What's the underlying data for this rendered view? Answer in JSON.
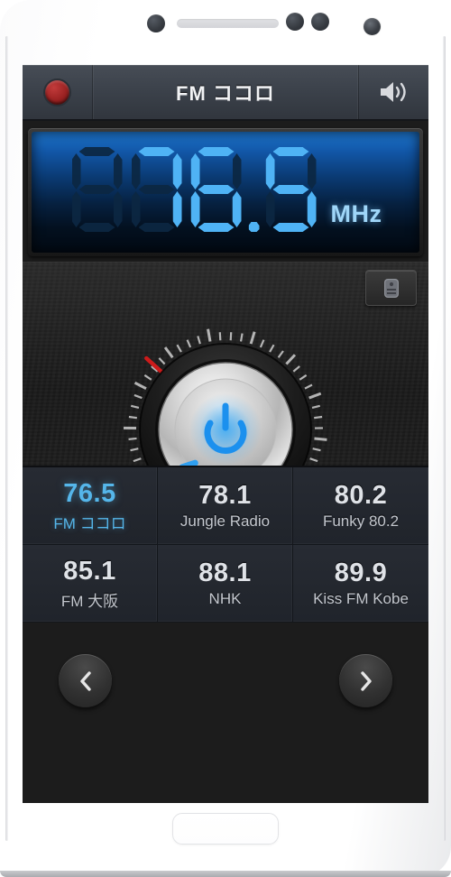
{
  "device": {
    "name": "smartphone-mockup",
    "body_color": "#ffffff"
  },
  "app": {
    "titlebar": {
      "title": "FM ココロ",
      "power_button": "power-led",
      "volume_icon": "speaker-icon"
    },
    "display": {
      "frequency": "76.5",
      "ghost_digits": "888.8",
      "unit": "MHz",
      "digit_color": "#4fb3f5",
      "ghost_color": "#0c2742",
      "background_color": "#06203f"
    },
    "tuner": {
      "lock_button_label": "lock-icon",
      "prev_button_label": "‹",
      "next_button_label": "›",
      "knob": {
        "icon": "power-icon",
        "indicator_color": "#cc1b1b",
        "indicator_angle_deg": 222,
        "tick_count": 44
      }
    },
    "presets": [
      {
        "freq": "76.5",
        "name": "FM ココロ",
        "active": true
      },
      {
        "freq": "78.1",
        "name": "Jungle Radio",
        "active": false
      },
      {
        "freq": "80.2",
        "name": "Funky 80.2",
        "active": false
      },
      {
        "freq": "85.1",
        "name": "FM 大阪",
        "active": false
      },
      {
        "freq": "88.1",
        "name": "NHK",
        "active": false
      },
      {
        "freq": "89.9",
        "name": "Kiss FM Kobe",
        "active": false
      }
    ],
    "colors": {
      "accent": "#4fb3f5",
      "titlebar": "#3c424b",
      "panel": "#222222",
      "preset_bg": "#242830"
    }
  }
}
